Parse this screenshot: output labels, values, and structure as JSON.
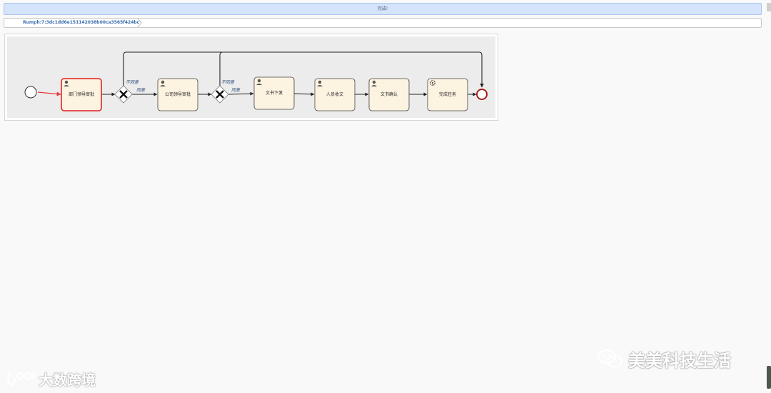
{
  "status": {
    "message": "完成!"
  },
  "breadcrumb": {
    "process_id": "Rumph:7:3dc1dd6e151142038b00ca3565f424bc"
  },
  "diagram": {
    "tasks": [
      {
        "label": "部门领导审批",
        "type": "user"
      },
      {
        "label": "公司领导审批",
        "type": "user"
      },
      {
        "label": "文书下发",
        "type": "user"
      },
      {
        "label": "人员收文",
        "type": "user"
      },
      {
        "label": "文书确认",
        "type": "user"
      },
      {
        "label": "完成任务",
        "type": "service"
      }
    ],
    "flow_labels": {
      "gateway1_reject": "不同意",
      "gateway1_approve": "同意",
      "gateway2_reject": "不同意",
      "gateway2_approve": "同意"
    },
    "colors": {
      "task_fill": "#fdf3e1",
      "active_border": "#e33b3b",
      "end_border": "#a81d1d"
    }
  },
  "watermarks": {
    "left": "大数跨境",
    "right": "美美科技生活"
  }
}
